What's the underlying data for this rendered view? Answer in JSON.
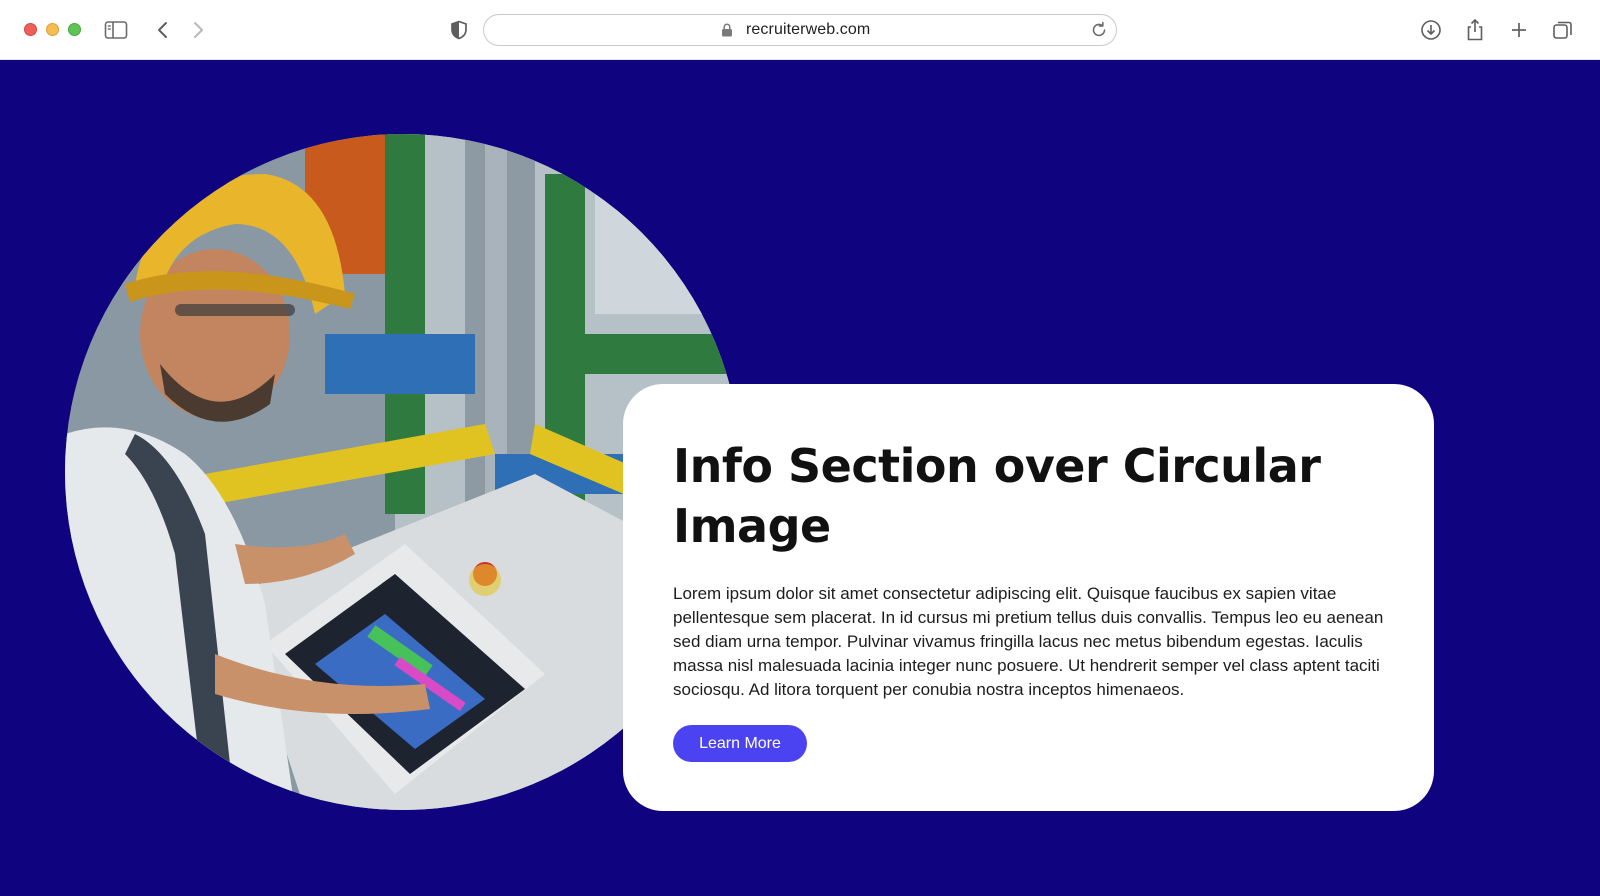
{
  "browser": {
    "url": "recruiterweb.com",
    "icons": {
      "sidebar": "sidebar-toggle-icon",
      "back": "chevron-left-icon",
      "forward": "chevron-right-icon",
      "privacy": "shield-icon",
      "lock": "lock-icon",
      "reload": "reload-icon",
      "download": "download-icon",
      "share": "share-icon",
      "new_tab": "plus-icon",
      "tabs": "tabs-overview-icon"
    },
    "traffic_colors": [
      "#ee5f57",
      "#f5bd4f",
      "#5fc454"
    ]
  },
  "page": {
    "background_color": "#10037f",
    "hero_image": {
      "alt": "Worker in hard hat and safety glasses operating an industrial touchscreen control panel"
    },
    "info_card": {
      "title": "Info Section over Circular Image",
      "body": "Lorem ipsum dolor sit amet consectetur adipiscing elit. Quisque faucibus ex sapien vitae pellentesque sem placerat. In id cursus mi pretium tellus duis convallis. Tempus leo eu aenean sed diam urna tempor. Pulvinar vivamus fringilla lacus nec metus bibendum egestas. Iaculis massa nisl malesuada lacinia integer nunc posuere. Ut hendrerit semper vel class aptent taciti sociosqu. Ad litora torquent per conubia nostra inceptos himenaeos.",
      "button_label": "Learn More",
      "button_color": "#4b43f1"
    }
  }
}
